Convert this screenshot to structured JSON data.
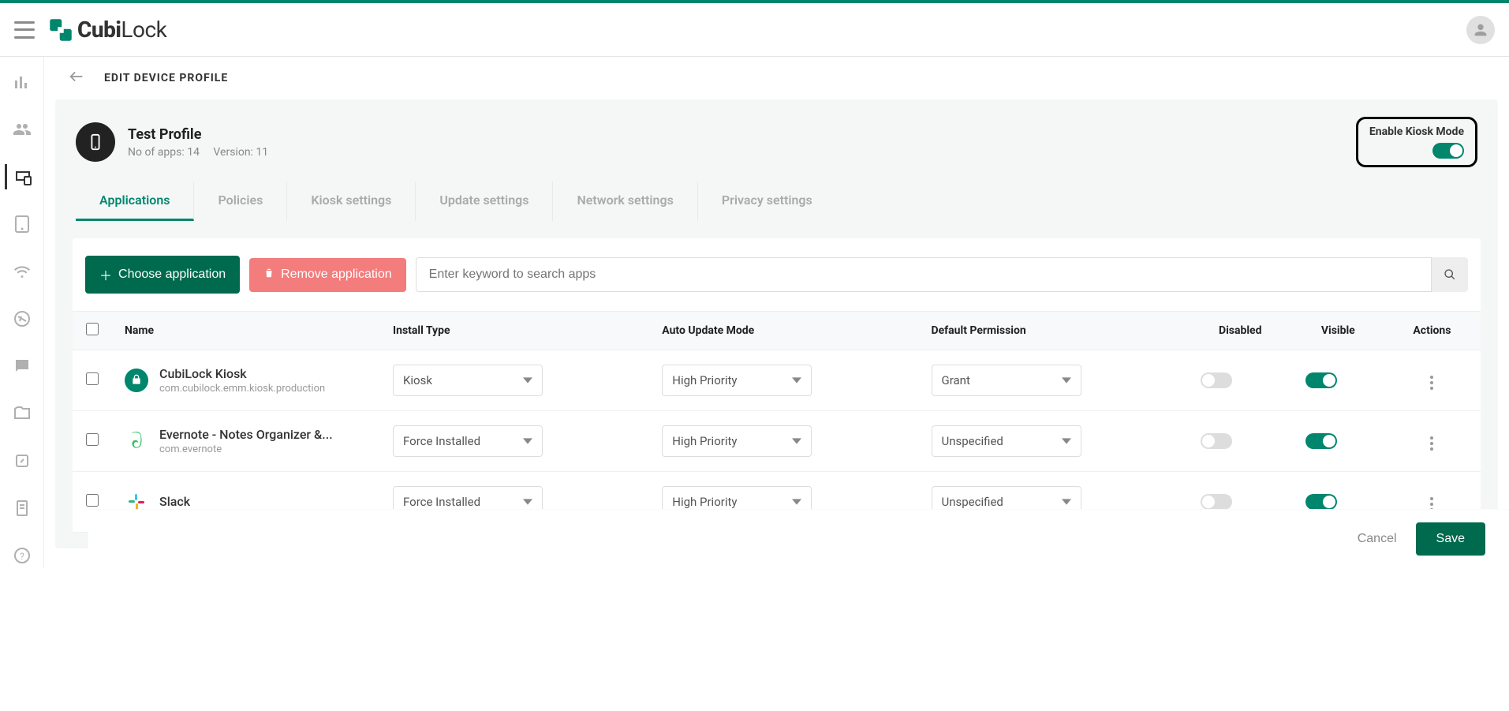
{
  "brand": {
    "name_bold": "Cubi",
    "name_light": "Lock"
  },
  "breadcrumb": {
    "title": "EDIT DEVICE PROFILE"
  },
  "profile": {
    "name": "Test Profile",
    "apps_label": "No of apps: 14",
    "version_label": "Version: 11"
  },
  "kiosk": {
    "label": "Enable Kiosk Mode",
    "enabled": true
  },
  "tabs": [
    {
      "label": "Applications",
      "active": true
    },
    {
      "label": "Policies"
    },
    {
      "label": "Kiosk settings"
    },
    {
      "label": "Update settings"
    },
    {
      "label": "Network settings"
    },
    {
      "label": "Privacy settings"
    }
  ],
  "toolbar": {
    "choose_label": "Choose application",
    "remove_label": "Remove application",
    "search_placeholder": "Enter keyword to search apps"
  },
  "table": {
    "headers": {
      "name": "Name",
      "install": "Install Type",
      "update": "Auto Update Mode",
      "permission": "Default Permission",
      "disabled": "Disabled",
      "visible": "Visible",
      "actions": "Actions"
    },
    "rows": [
      {
        "name": "CubiLock Kiosk",
        "pkg": "com.cubilock.emm.kiosk.production",
        "install": "Kiosk",
        "update": "High Priority",
        "permission": "Grant",
        "disabled": false,
        "visible": true,
        "icon": "cubilock"
      },
      {
        "name": "Evernote - Notes Organizer &...",
        "pkg": "com.evernote",
        "install": "Force Installed",
        "update": "High Priority",
        "permission": "Unspecified",
        "disabled": false,
        "visible": true,
        "icon": "evernote"
      },
      {
        "name": "Slack",
        "pkg": "",
        "install": "Force Installed",
        "update": "High Priority",
        "permission": "Unspecified",
        "disabled": false,
        "visible": true,
        "icon": "slack"
      }
    ]
  },
  "footer": {
    "cancel": "Cancel",
    "save": "Save"
  }
}
